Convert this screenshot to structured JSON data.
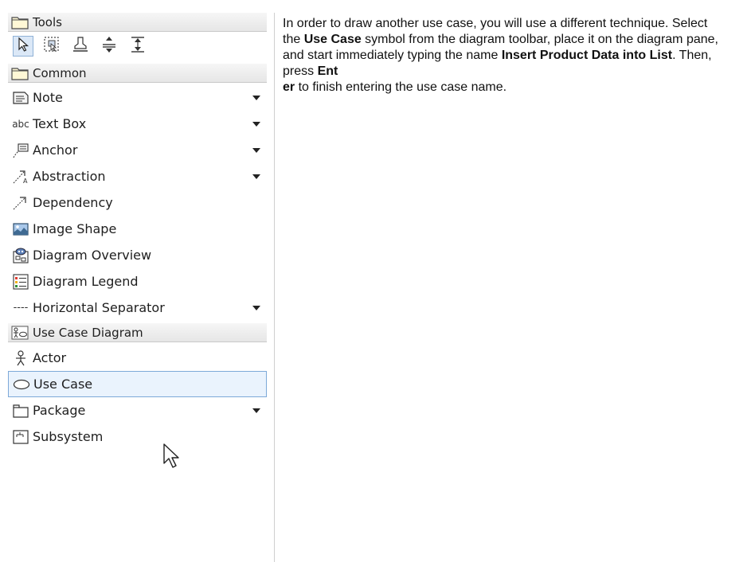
{
  "palette": {
    "groups": [
      {
        "label": "Tools",
        "icon": "folder-icon"
      },
      {
        "label": "Common",
        "icon": "folder-icon"
      },
      {
        "label": "Use Case Diagram",
        "icon": "use-case-diagram-icon"
      }
    ],
    "tools": [
      {
        "name": "pointer-icon",
        "active": true
      },
      {
        "name": "rectangular-selection-icon",
        "active": false
      },
      {
        "name": "stamp-icon",
        "active": false
      },
      {
        "name": "insert-space-icon",
        "active": false
      },
      {
        "name": "insert-horizontal-space-icon",
        "active": false
      }
    ],
    "common_items": [
      {
        "label": "Note",
        "icon": "note-icon",
        "dropdown": true
      },
      {
        "label": "Text Box",
        "icon": "text-box-icon",
        "icon_text": "abc",
        "dropdown": true
      },
      {
        "label": "Anchor",
        "icon": "anchor-icon",
        "dropdown": true
      },
      {
        "label": "Abstraction",
        "icon": "abstraction-icon",
        "dropdown": true
      },
      {
        "label": "Dependency",
        "icon": "dependency-icon",
        "dropdown": false
      },
      {
        "label": "Image Shape",
        "icon": "image-icon",
        "dropdown": false
      },
      {
        "label": "Diagram Overview",
        "icon": "diagram-overview-icon",
        "dropdown": false
      },
      {
        "label": "Diagram Legend",
        "icon": "diagram-legend-icon",
        "dropdown": false
      },
      {
        "label": "Horizontal Separator",
        "icon": "horizontal-separator-icon",
        "icon_text": "----",
        "dropdown": true
      }
    ],
    "use_case_items": [
      {
        "label": "Actor",
        "icon": "actor-icon",
        "dropdown": false,
        "selected": false
      },
      {
        "label": "Use Case",
        "icon": "use-case-icon",
        "dropdown": false,
        "selected": true
      },
      {
        "label": "Package",
        "icon": "package-icon",
        "dropdown": true,
        "selected": false
      },
      {
        "label": "Subsystem",
        "icon": "subsystem-icon",
        "dropdown": false,
        "selected": false
      }
    ]
  },
  "instructions": {
    "t1": "In order to draw another use case, you will use a different technique. Select the ",
    "b1": "Use Case",
    "t2": " symbol from the diagram toolbar, place it on the diagram pane, and start immediately typing the name ",
    "b2": "Insert Product Data into List",
    "t3": ". Then, press ",
    "b3": "Ent",
    "b4": "er",
    "t4": " to finish entering the use case name."
  },
  "colors": {
    "selection_border": "#7da9d8",
    "selection_fill": "#eaf3fd",
    "header_bg": "#e6e6e6"
  }
}
